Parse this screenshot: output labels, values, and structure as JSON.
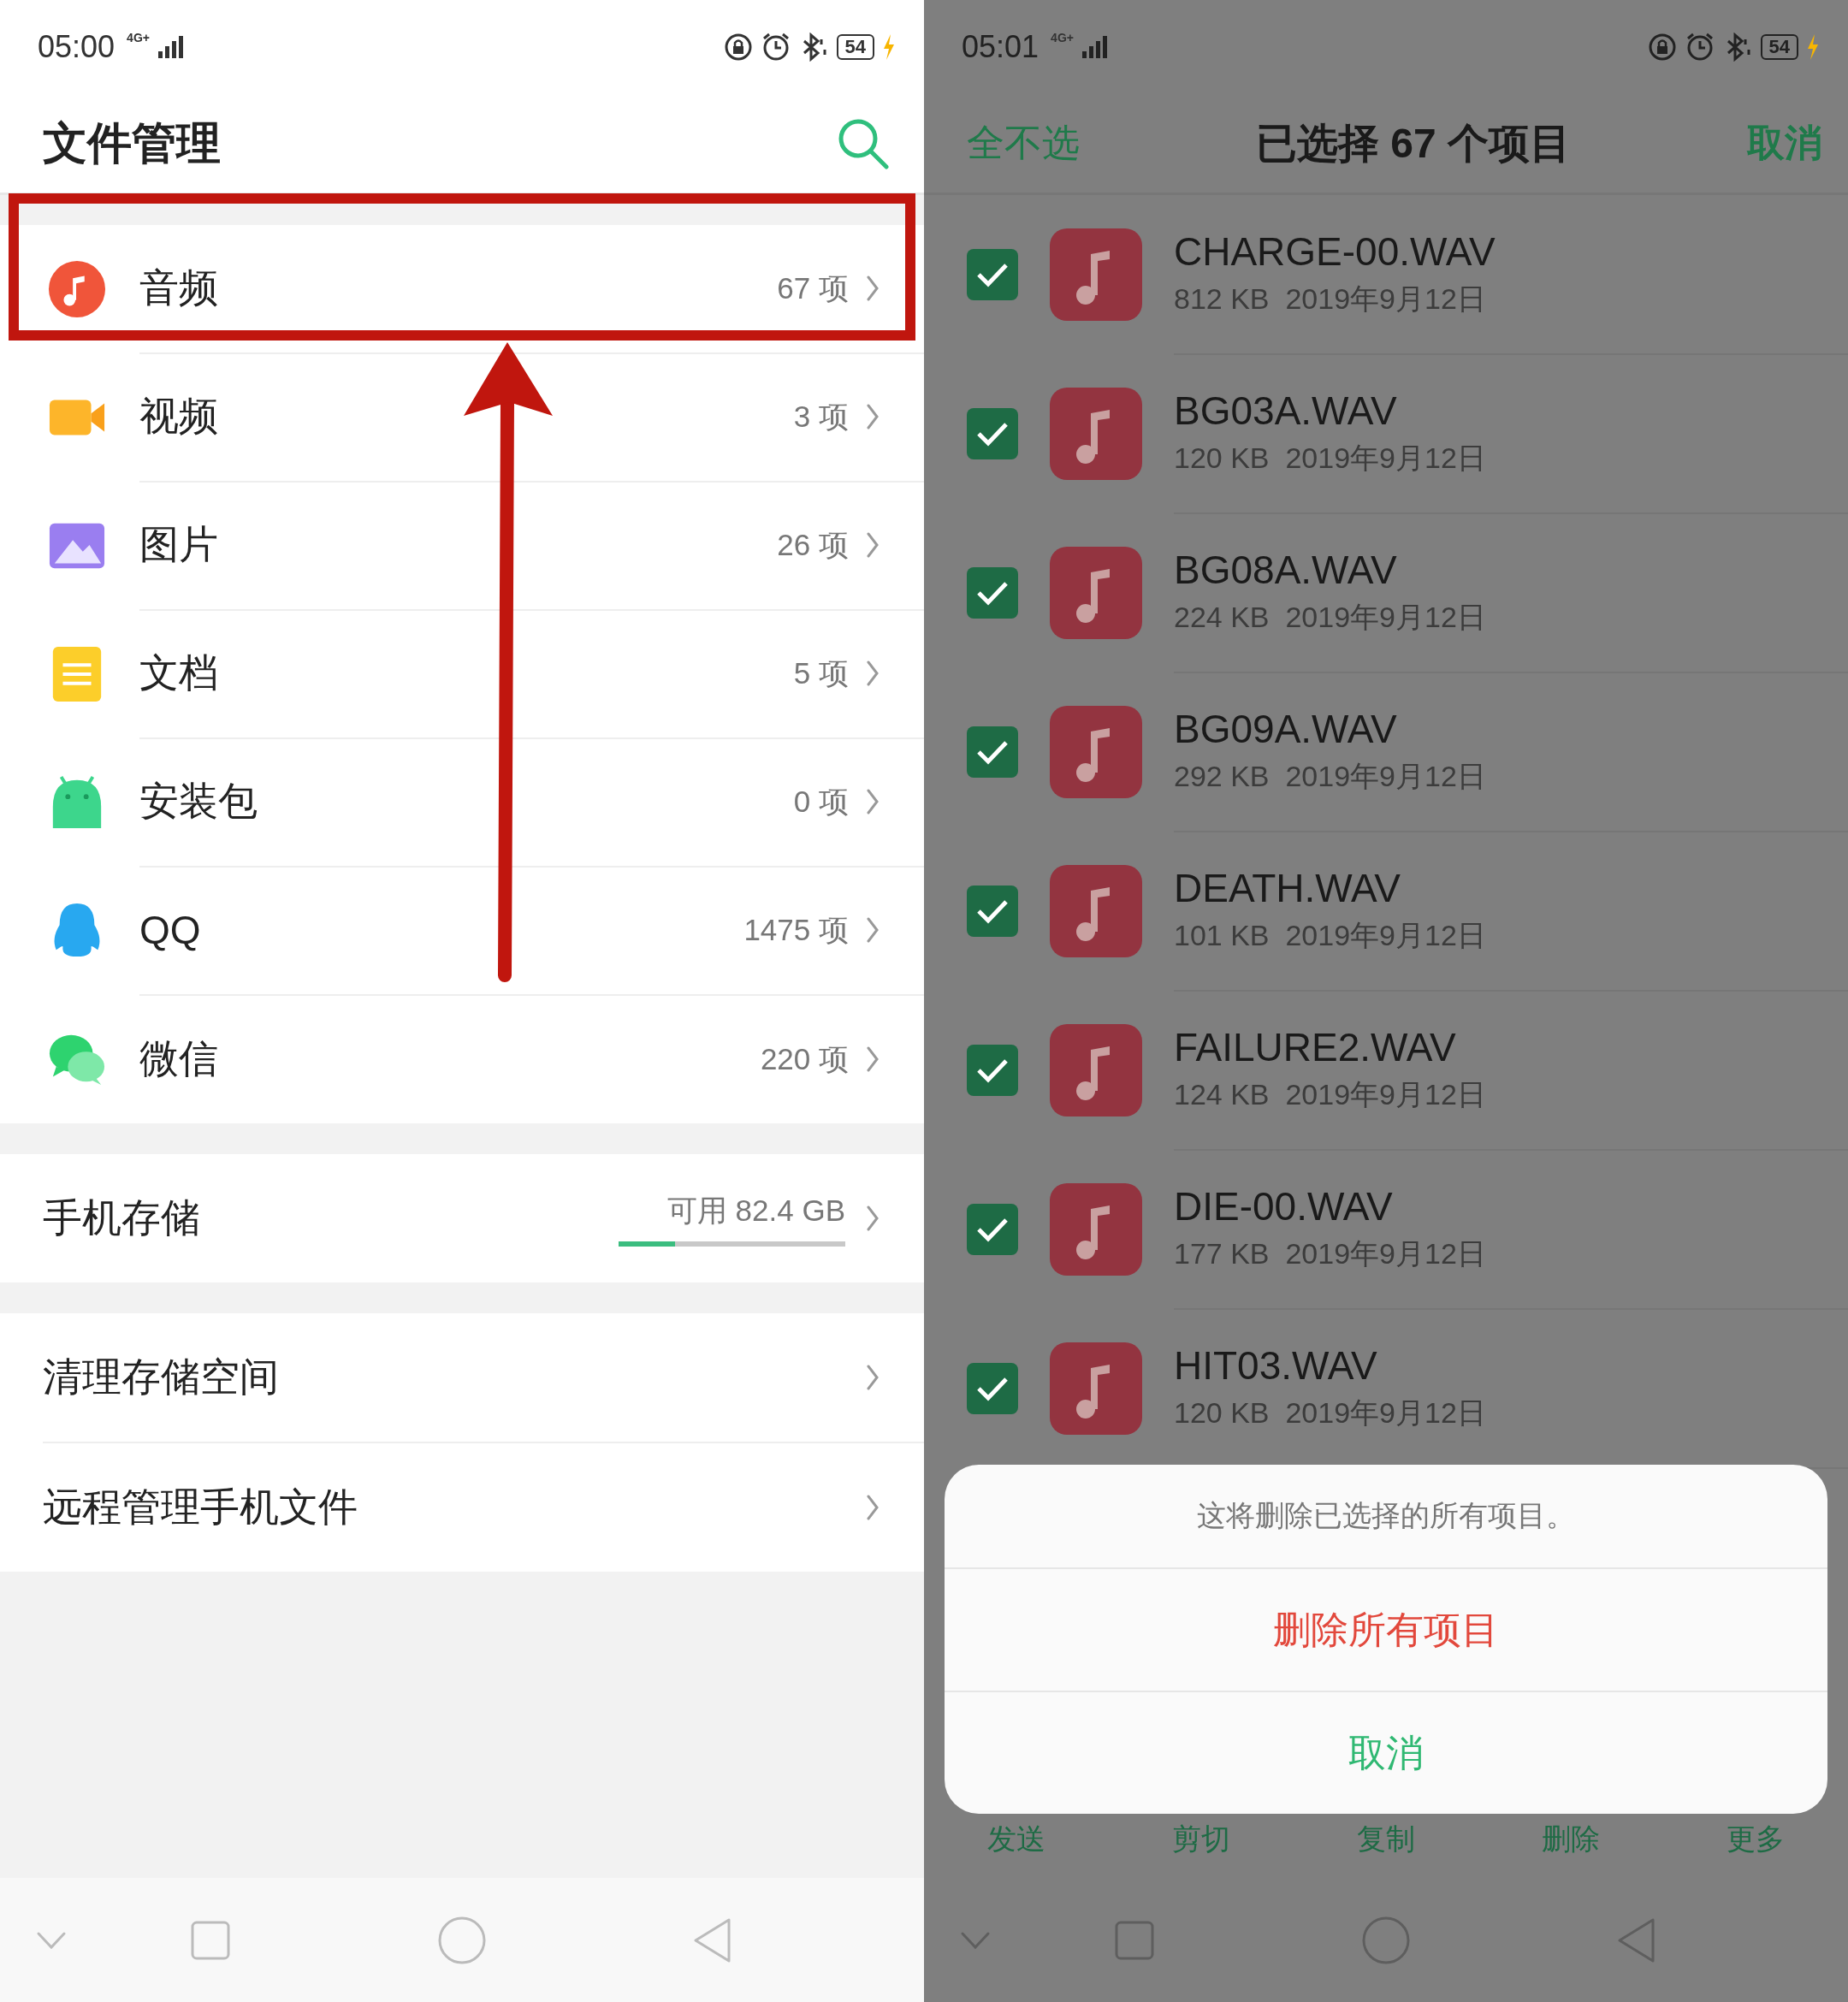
{
  "left_screen": {
    "status": {
      "time": "05:00",
      "network": "4G+",
      "battery": "54"
    },
    "title": "文件管理",
    "categories": [
      {
        "kind": "audio",
        "label": "音频",
        "count": "67 项"
      },
      {
        "kind": "video",
        "label": "视频",
        "count": "3 项"
      },
      {
        "kind": "image",
        "label": "图片",
        "count": "26 项"
      },
      {
        "kind": "document",
        "label": "文档",
        "count": "5 项"
      },
      {
        "kind": "apk",
        "label": "安装包",
        "count": "0 项"
      },
      {
        "kind": "qq",
        "label": "QQ",
        "count": "1475 项"
      },
      {
        "kind": "chat",
        "label": "微信",
        "count": "220 项"
      }
    ],
    "storage": {
      "label": "手机存储",
      "free": "可用 82.4 GB",
      "level": 0.25
    },
    "actions": [
      "清理存储空间",
      "远程管理手机文件"
    ]
  },
  "right_screen": {
    "status": {
      "time": "05:01",
      "network": "4G+",
      "battery": "54"
    },
    "header": {
      "deselect_all": "全不选",
      "title": "已选择 67 个项目",
      "cancel": "取消"
    },
    "files": [
      {
        "name": "CHARGE-00.WAV",
        "size": "812 KB",
        "date": "2019年9月12日",
        "checked": true
      },
      {
        "name": "BG03A.WAV",
        "size": "120 KB",
        "date": "2019年9月12日",
        "checked": true
      },
      {
        "name": "BG08A.WAV",
        "size": "224 KB",
        "date": "2019年9月12日",
        "checked": true
      },
      {
        "name": "BG09A.WAV",
        "size": "292 KB",
        "date": "2019年9月12日",
        "checked": true
      },
      {
        "name": "DEATH.WAV",
        "size": "101 KB",
        "date": "2019年9月12日",
        "checked": true
      },
      {
        "name": "FAILURE2.WAV",
        "size": "124 KB",
        "date": "2019年9月12日",
        "checked": true
      },
      {
        "name": "DIE-00.WAV",
        "size": "177 KB",
        "date": "2019年9月12日",
        "checked": true
      },
      {
        "name": "HIT03.WAV",
        "size": "120 KB",
        "date": "2019年9月12日",
        "checked": true
      }
    ],
    "dialog": {
      "message": "这将删除已选择的所有项目。",
      "confirm": "删除所有项目",
      "cancel": "取消"
    },
    "toolbar": [
      "发送",
      "剪切",
      "复制",
      "删除",
      "更多"
    ]
  }
}
